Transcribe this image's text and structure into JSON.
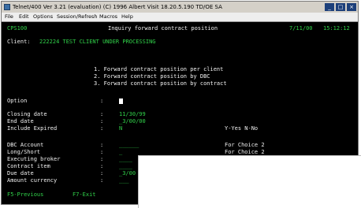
{
  "window": {
    "title": "Telnet/400 Ver 3.21 (evaluation) (C) 1996 Albert Visit  18.20.5.190 TD/OE SA",
    "buttons": [
      "_",
      "□",
      "×"
    ]
  },
  "menu": [
    "File",
    "Edit",
    "Options",
    "Session/Refresh",
    "Macros",
    "Help"
  ],
  "screen": {
    "program": "CPS100",
    "heading": "Inquiry forward contract position",
    "date": "7/11/00",
    "time": "15:12:12",
    "client_label": "Client:",
    "client_value": "222224 TEST CLIENT UNDER PROCESSING",
    "choices": [
      "1. Forward contract position per client",
      "2. Forward contract position by DBC",
      "3. Forward contract position by contract"
    ],
    "fields": [
      {
        "label": "Option",
        "sep": ":",
        "value": ""
      },
      {
        "label": "Closing date",
        "sep": ":",
        "value": "11/30/99"
      },
      {
        "label": "End date",
        "sep": ":",
        "value": "_3/00/00"
      },
      {
        "label": "Include Expired",
        "sep": ":",
        "value": "N"
      },
      {
        "label": "DBC Account",
        "sep": ":",
        "value": "______"
      },
      {
        "label": "Long/Short",
        "sep": ":",
        "value": "_"
      },
      {
        "label": "Executing broker",
        "sep": ":",
        "value": "____"
      },
      {
        "label": "Contract item",
        "sep": ":",
        "value": "____"
      },
      {
        "label": "Due date",
        "sep": ":",
        "value": "_3/00"
      },
      {
        "label": "Amount currency",
        "sep": ":",
        "value": "___"
      }
    ],
    "hints": {
      "yes_no": "Y-Yes N-No",
      "choice2_a": "For Choice 2",
      "choice2_b": "For Choice 2"
    },
    "function_keys": {
      "f5": "F5-Previous",
      "f7": "F7-Exit"
    }
  },
  "colors": {
    "terminal_background": "#000000",
    "terminal_green": "#31d24a",
    "terminal_white": "#f2f2f2",
    "title_button": "#1c3f7a"
  }
}
